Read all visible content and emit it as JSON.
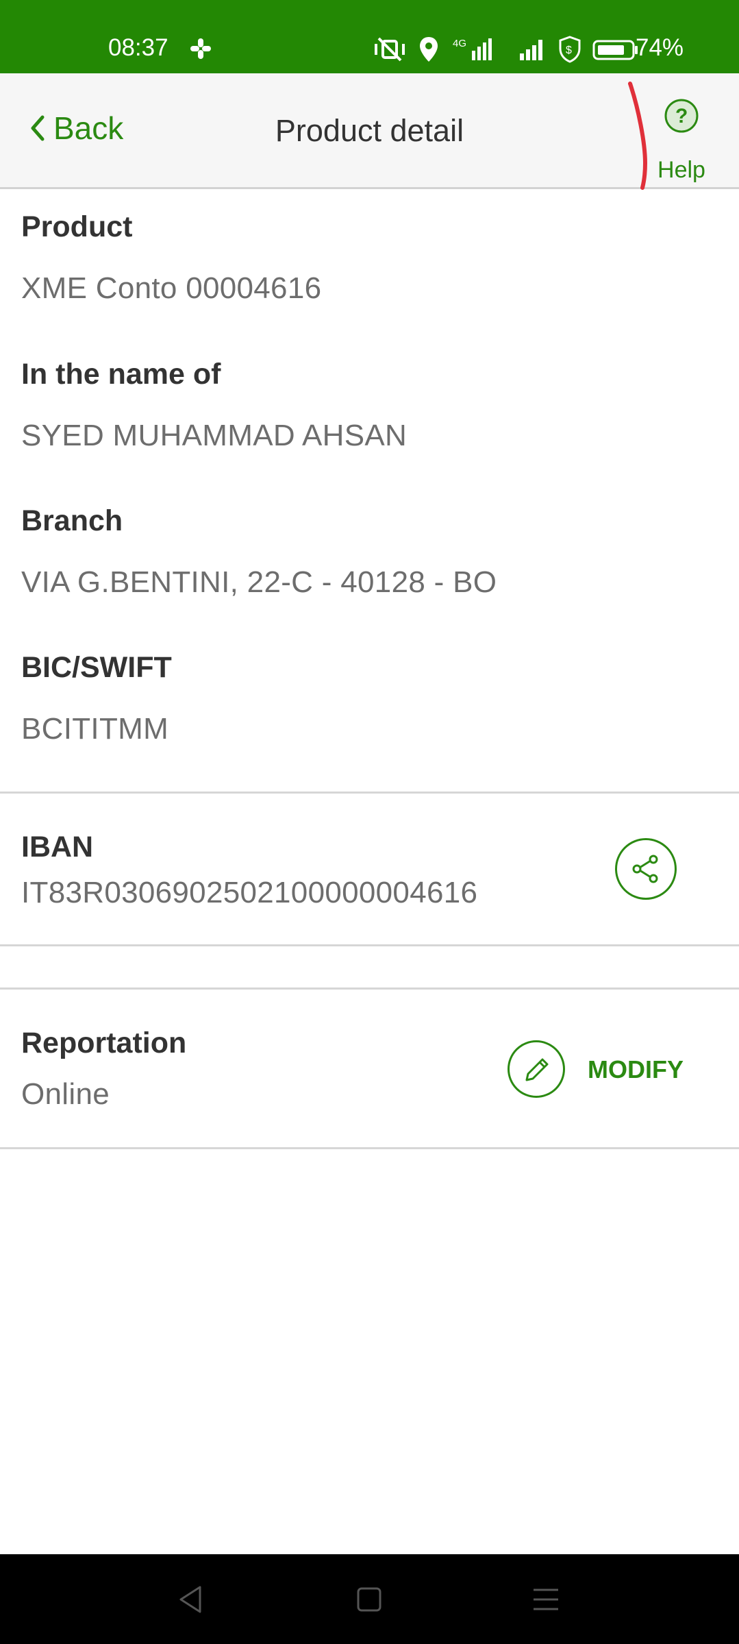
{
  "status_bar": {
    "time": "08:37",
    "battery_percent": "74%",
    "network_label": "4G",
    "background_color": "#238804"
  },
  "nav": {
    "back_label": "Back",
    "title": "Product detail",
    "help_label": "Help",
    "accent_color": "#2b8a12"
  },
  "details": {
    "product": {
      "label": "Product",
      "value": "XME Conto 00004616"
    },
    "holder": {
      "label": "In the name of",
      "value": "SYED MUHAMMAD AHSAN"
    },
    "branch": {
      "label": "Branch",
      "value": "VIA G.BENTINI, 22-C - 40128  - BO"
    },
    "bic": {
      "label": "BIC/SWIFT",
      "value": "BCITITMM"
    }
  },
  "iban": {
    "label": "IBAN",
    "value": "IT83R0306902502100000004616",
    "share_icon": "share-icon"
  },
  "reportation": {
    "label": "Reportation",
    "value": "Online",
    "modify_label": "MODIFY",
    "modify_icon": "pencil-icon"
  },
  "system_nav": {
    "icons": [
      "back-triangle-icon",
      "home-square-icon",
      "menu-lines-icon"
    ]
  }
}
